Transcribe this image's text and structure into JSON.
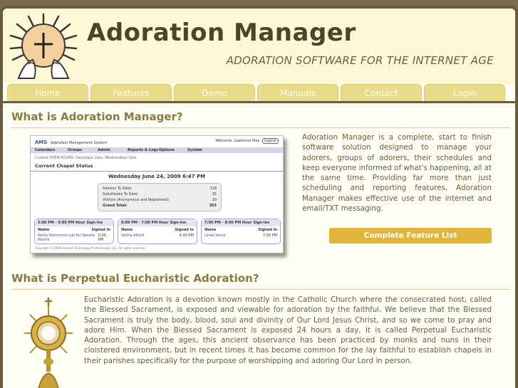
{
  "header": {
    "title": "Adoration Manager",
    "tagline": "ADORATION SOFTWARE FOR THE INTERNET AGE"
  },
  "nav": {
    "items": [
      "Home",
      "Features",
      "Demo",
      "Manuals",
      "Contact",
      "Login"
    ]
  },
  "section1": {
    "title": "What is Adoration Manager?",
    "text": "Adoration Manager is a complete, start to finish software solution designed to manage your adorers, groups of adorers, their schedules and keep everyone informed of what's happening, all at the same time. Providing far more than just scheduling and reporting features, Adoration Manager makes effective use of the internet and email/TXT messaging.",
    "button": "Complete Feature List"
  },
  "screenshot": {
    "brand": "AMS",
    "brand_sub": "Adoration Management System",
    "welcome": "Welcome, Lawrence May",
    "logout": "Logout",
    "menu": [
      "Calendars",
      "Groups",
      "Admin",
      "Reports & Logs",
      "Options",
      "System"
    ],
    "open_hours": "Current OPEN HOURS: Saturdays 2am, Wednesdays 2pm",
    "status_title": "Current Chapel Status",
    "datetime": "Wednesday June 24, 2009 6:47 PM",
    "stats": [
      {
        "label": "Adorers To Date:",
        "value": "318"
      },
      {
        "label": "Substitutes To Date:",
        "value": "35"
      },
      {
        "label": "Visitors (Anonymous and Registered):",
        "value": "10"
      },
      {
        "label": "Grand Total:",
        "value": "363"
      }
    ],
    "hours": [
      {
        "title": "5:00 PM - 6:00 PM Hour Sign-Ins",
        "name": "Nellie Hammond sub for Natalie Mathis",
        "time": "5:00 PM"
      },
      {
        "title": "6:00 PM - 7:00 PM Hour Sign-Ins",
        "name": "Selma Alford",
        "time": "6:00 PM"
      },
      {
        "title": "7:00 PM - 8:00 PM Hour Sign-Ins",
        "name": "Linda Verne",
        "time": "7:00 PM"
      }
    ],
    "col_name": "Name",
    "col_signed": "Signed In",
    "footer": "Copyright © 2009 Hallman Technology Professionals, LLC. All rights reserved."
  },
  "section2": {
    "title": "What is Perpetual Eucharistic Adoration?",
    "text": "Eucharistic Adoration is a devotion known mostly in the Catholic Church where the consecrated host, called the Blessed Sacrament, is exposed and viewable for adoration by the faithful. We believe that the Blessed Sacrament is truly the body, blood, soul and divinity of Our Lord Jesus Christ, and so we come to pray and adore Him. When the Blessed Sacrament is exposed 24 hours a day, it is called Perpetual Eucharistic Adoration. Through the ages, this ancient observance has been practiced by monks and nuns in their cloistered environment, but in recent times it has become common for the lay faithful to establish chapels in their parishes specifically for the purpose of worshipping and adoring Our Lord in person."
  },
  "colors": {
    "frame": "#6b5a3c",
    "header_bg": "#fdf8d6",
    "nav_tab": "#e8dc8a",
    "title": "#4f4428",
    "accent": "#8a7a42",
    "button": "#e0b53a"
  }
}
